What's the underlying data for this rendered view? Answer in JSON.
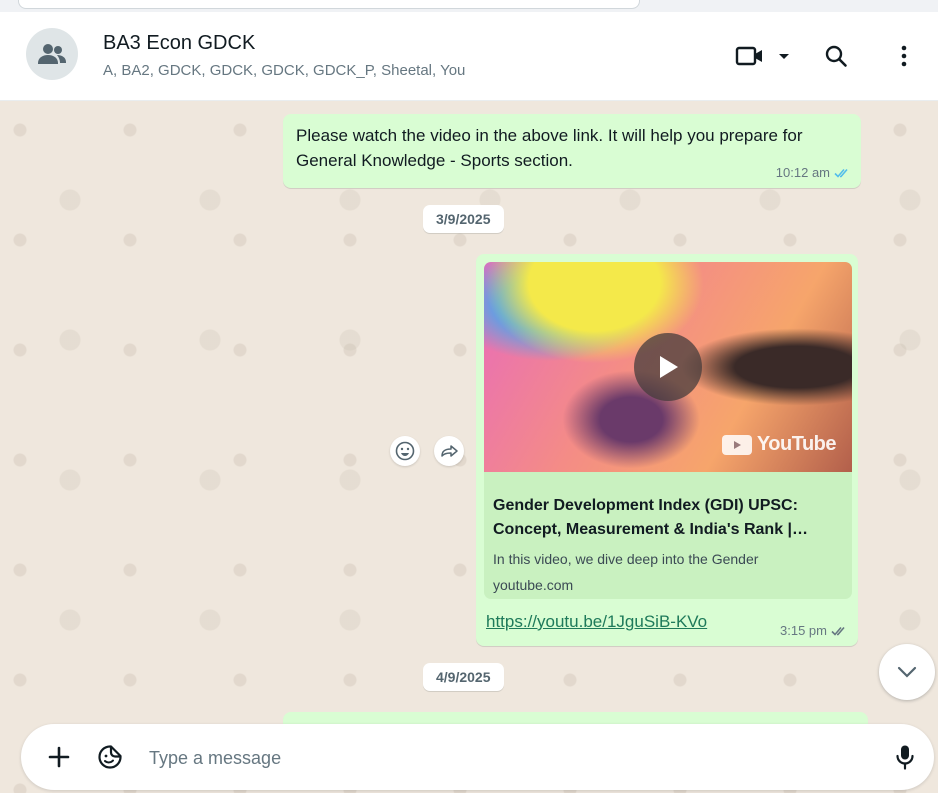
{
  "header": {
    "title": "BA3 Econ GDCK",
    "members": "A, BA2, GDCK, GDCK, GDCK, GDCK_P, Sheetal, You"
  },
  "messages": [
    {
      "text": "Please watch the video in the above link. It will help you prepare for General Knowledge - Sports section.",
      "time": "10:12 am"
    },
    {
      "preview_title": "Gender Development Index (GDI) UPSC: Concept, Measurement & India's Rank |…",
      "preview_description": "In this video, we dive deep into the Gender",
      "preview_domain": "youtube.com",
      "thumbnail_brand": "YouTube",
      "link": "https://youtu.be/1JguSiB-KVo",
      "time": "3:15 pm"
    }
  ],
  "dates": [
    "3/9/2025",
    "4/9/2025"
  ],
  "composer": {
    "placeholder": "Type a message"
  },
  "colors": {
    "outgoing_bubble": "#d9fdd3",
    "link_preview": "#c9f1c0",
    "read_tick": "#53bdeb",
    "link_text": "#1e7a5a"
  },
  "icons": [
    "group-avatar-icon",
    "video-call-icon",
    "chevron-down-icon",
    "search-icon",
    "menu-icon",
    "double-check-icon",
    "play-icon",
    "youtube-icon",
    "emoji-icon",
    "forward-icon",
    "plus-icon",
    "sticker-icon",
    "mic-icon"
  ]
}
